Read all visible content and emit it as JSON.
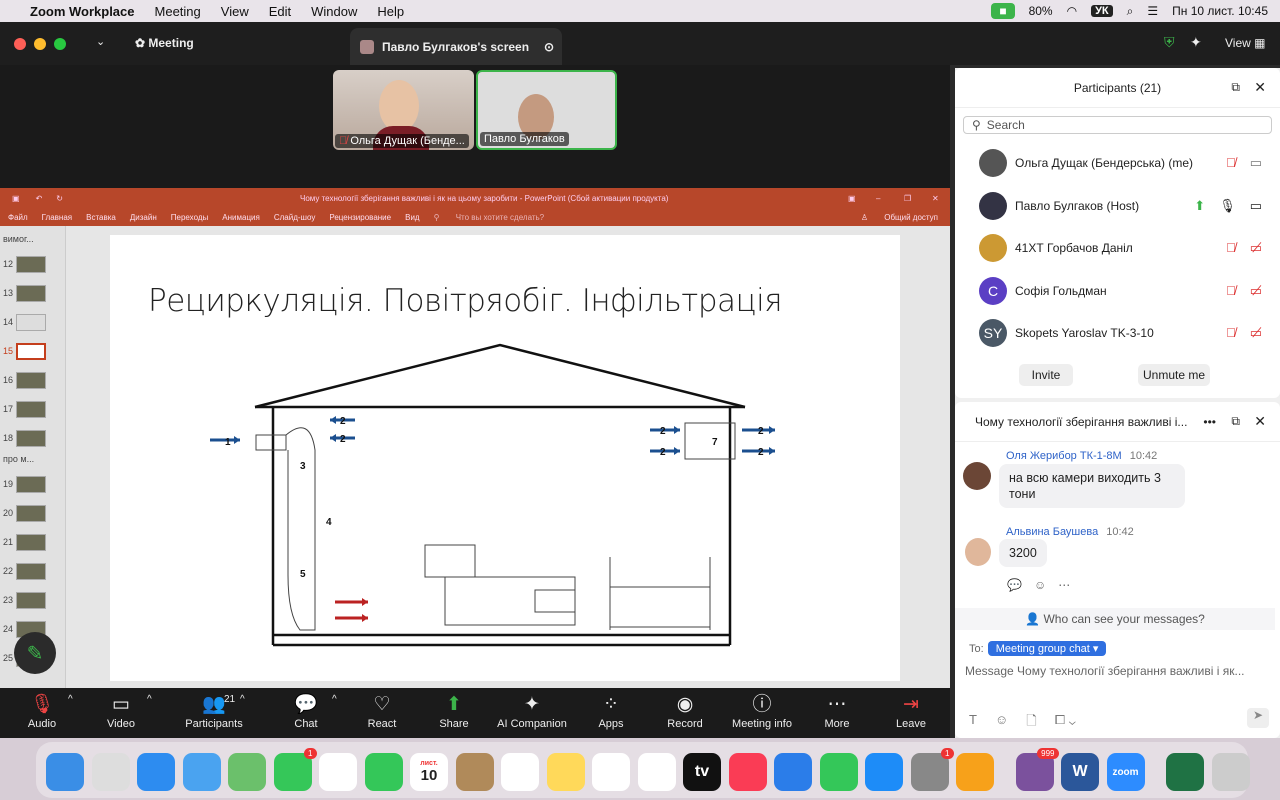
{
  "menubar": {
    "app": "Zoom Workplace",
    "items": [
      "Meeting",
      "View",
      "Edit",
      "Window",
      "Help"
    ],
    "battery": "80%",
    "lang": "УК",
    "datetime": "Пн 10 лист.  10:45"
  },
  "window": {
    "meeting_label": "Meeting",
    "share_title": "Павло Булгаков's screen",
    "view_label": "View"
  },
  "videos": [
    {
      "name": "Ольга Дущак (Бенде..."
    },
    {
      "name": "Павло Булгаков"
    }
  ],
  "ppt": {
    "title": "Чому технології зберігання важливі і як на цьому заробити - PowerPoint (Сбой активации продукта)",
    "tabs": [
      "Файл",
      "Главная",
      "Вставка",
      "Дизайн",
      "Переходы",
      "Анимация",
      "Слайд-шоу",
      "Рецензирование",
      "Вид"
    ],
    "tellme": "Что вы хотите сделать?",
    "share": "Общий доступ",
    "section1": "вимог...",
    "section2": "про м...",
    "slide_numbers": [
      "12",
      "13",
      "14",
      "15",
      "16",
      "17",
      "18",
      "19",
      "20",
      "21",
      "22",
      "23",
      "24",
      "25"
    ],
    "slide_title": "Рециркуляція. Повітряобіг. Інфільтрація",
    "diagram_labels": [
      "1",
      "2",
      "2",
      "2",
      "2",
      "2",
      "2",
      "3",
      "4",
      "5",
      "7"
    ]
  },
  "participants": {
    "title": "Participants (21)",
    "search_placeholder": "Search",
    "list": [
      {
        "name": "Ольга Дущак (Бендерська) (me)",
        "initials": "",
        "color": "#555"
      },
      {
        "name": "Павло Булгаков (Host)",
        "initials": "",
        "color": "#334"
      },
      {
        "name": "41ХТ Горбачов Даніл",
        "initials": "",
        "color": "#c93"
      },
      {
        "name": "Софія Гольдман",
        "initials": "С",
        "color": "#5b3fc4"
      },
      {
        "name": "Skopets Yaroslav TK-3-10",
        "initials": "SY",
        "color": "#4a5866"
      }
    ],
    "invite": "Invite",
    "unmute": "Unmute me"
  },
  "chat": {
    "title": "Чому технології зберігання важливі і...",
    "messages": [
      {
        "sender": "Оля Жерибор ТК-1-8М",
        "time": "10:42",
        "text": "на всю камери виходить  3 тони"
      },
      {
        "sender": "Альвина Баушева",
        "time": "10:42",
        "text": "3200"
      }
    ],
    "privacy": "Who can see your messages?",
    "to_label": "To:",
    "to_value": "Meeting group chat",
    "placeholder": "Message Чому технології зберігання важливі і як..."
  },
  "toolbar": [
    {
      "label": "Audio",
      "icon": "mic-muted-icon",
      "glyph": "🎙"
    },
    {
      "label": "Video",
      "icon": "video-icon",
      "glyph": "▭"
    },
    {
      "label": "Participants",
      "icon": "participants-icon",
      "glyph": "👥",
      "count": "21"
    },
    {
      "label": "Chat",
      "icon": "chat-icon",
      "glyph": "💬"
    },
    {
      "label": "React",
      "icon": "heart-icon",
      "glyph": "♡"
    },
    {
      "label": "Share",
      "icon": "share-icon",
      "glyph": "⬆"
    },
    {
      "label": "AI Companion",
      "icon": "sparkle-icon",
      "glyph": "✦"
    },
    {
      "label": "Apps",
      "icon": "apps-icon",
      "glyph": "⁘"
    },
    {
      "label": "Record",
      "icon": "record-icon",
      "glyph": "◉"
    },
    {
      "label": "Meeting info",
      "icon": "info-icon",
      "glyph": "ⓘ"
    },
    {
      "label": "More",
      "icon": "more-icon",
      "glyph": "⋯"
    },
    {
      "label": "Leave",
      "icon": "leave-icon",
      "glyph": "⇥"
    }
  ],
  "dock": {
    "calendar_month": "лист.",
    "calendar_day": "10",
    "messages_badge": "1",
    "settings_badge": "1",
    "viber_badge": "999",
    "zoom_label": "zoom",
    "word_label": "W",
    "tv_label": "tv"
  }
}
